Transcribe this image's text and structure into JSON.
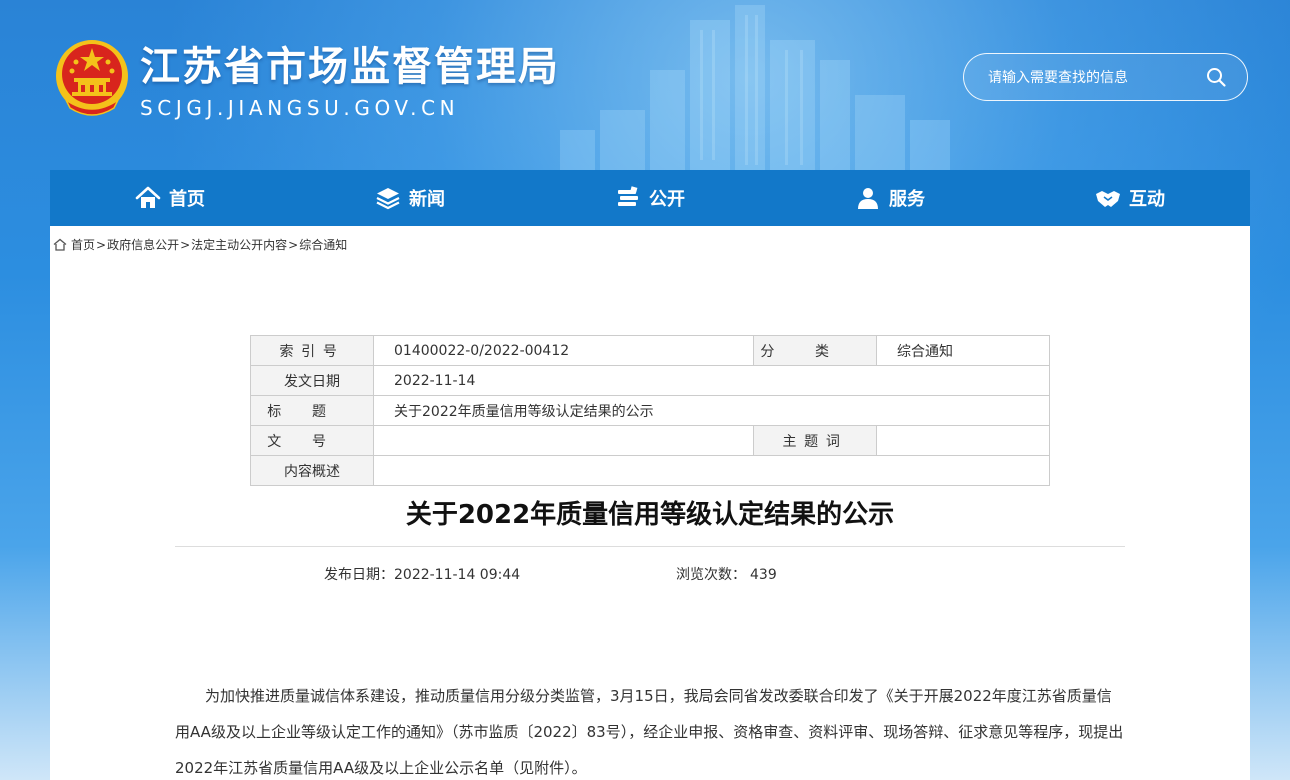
{
  "header": {
    "site_title": "江苏省市场监督管理局",
    "site_domain": "SCJGJ.JIANGSU.GOV.CN",
    "search_placeholder": "请输入需要查找的信息"
  },
  "nav": {
    "items": [
      {
        "label": "首页",
        "icon": "home-icon"
      },
      {
        "label": "新闻",
        "icon": "layers-icon"
      },
      {
        "label": "公开",
        "icon": "books-icon"
      },
      {
        "label": "服务",
        "icon": "user-icon"
      },
      {
        "label": "互动",
        "icon": "handshake-icon"
      }
    ]
  },
  "breadcrumb": {
    "items": [
      "首页",
      "政府信息公开",
      "法定主动公开内容",
      "综合通知"
    ],
    "separator": ">"
  },
  "meta": {
    "index_label": "索引号",
    "index_value": "01400022-0/2022-00412",
    "category_label": "分类",
    "category_value": "综合通知",
    "date_label": "发文日期",
    "date_value": "2022-11-14",
    "title_label": "标题",
    "title_value": "关于2022年质量信用等级认定结果的公示",
    "doc_no_label": "文号",
    "doc_no_value": "",
    "keyword_label": "主题词",
    "keyword_value": "",
    "summary_label": "内容概述",
    "summary_value": ""
  },
  "article": {
    "title": "关于2022年质量信用等级认定结果的公示",
    "publish_date_label": "发布日期：",
    "publish_date": "2022-11-14 09:44",
    "views_label": "浏览次数：",
    "views": "439",
    "paragraph_1": "为加快推进质量诚信体系建设，推动质量信用分级分类监管，3月15日，我局会同省发改委联合印发了《关于开展2022年度江苏省质量信用AA级及以上企业等级认定工作的通知》（苏市监质〔2022〕83号），经企业申报、资格审查、资料评审、现场答辩、征求意见等程序，现提出2022年江苏省质量信用AA级及以上企业公示名单（见附件）。"
  },
  "colors": {
    "nav_bg": "#1278c9",
    "header_bg": "#2a83d6",
    "emblem_red": "#d8251d",
    "emblem_gold": "#f4c21a"
  }
}
